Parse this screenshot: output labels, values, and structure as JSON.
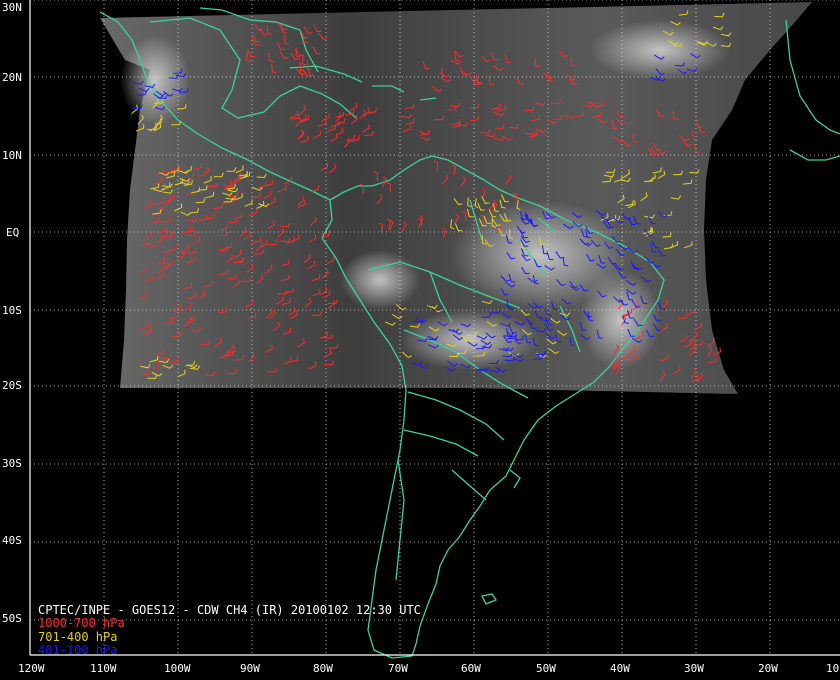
{
  "title": "CPTEC/INPE - GOES12 - CDW CH4 (IR) 20100102 12:30 UTC",
  "legend": [
    {
      "label": "1000-700 hPa",
      "color": "#ff2a2a"
    },
    {
      "label": "701-400 hPa",
      "color": "#e6d21e"
    },
    {
      "label": "401-100 hPa",
      "color": "#1a1aff"
    }
  ],
  "lat_labels": [
    "30N",
    "20N",
    "10N",
    "EQ",
    "10S",
    "20S",
    "30S",
    "40S",
    "50S"
  ],
  "lon_labels": [
    "120W",
    "110W",
    "100W",
    "90W",
    "80W",
    "70W",
    "60W",
    "50W",
    "40W",
    "30W",
    "20W",
    "10"
  ],
  "colors": {
    "coastline": "#3ad39a",
    "grid": "#ffffff",
    "frame": "#ffffff",
    "image_bg": "#4a4a4a"
  }
}
